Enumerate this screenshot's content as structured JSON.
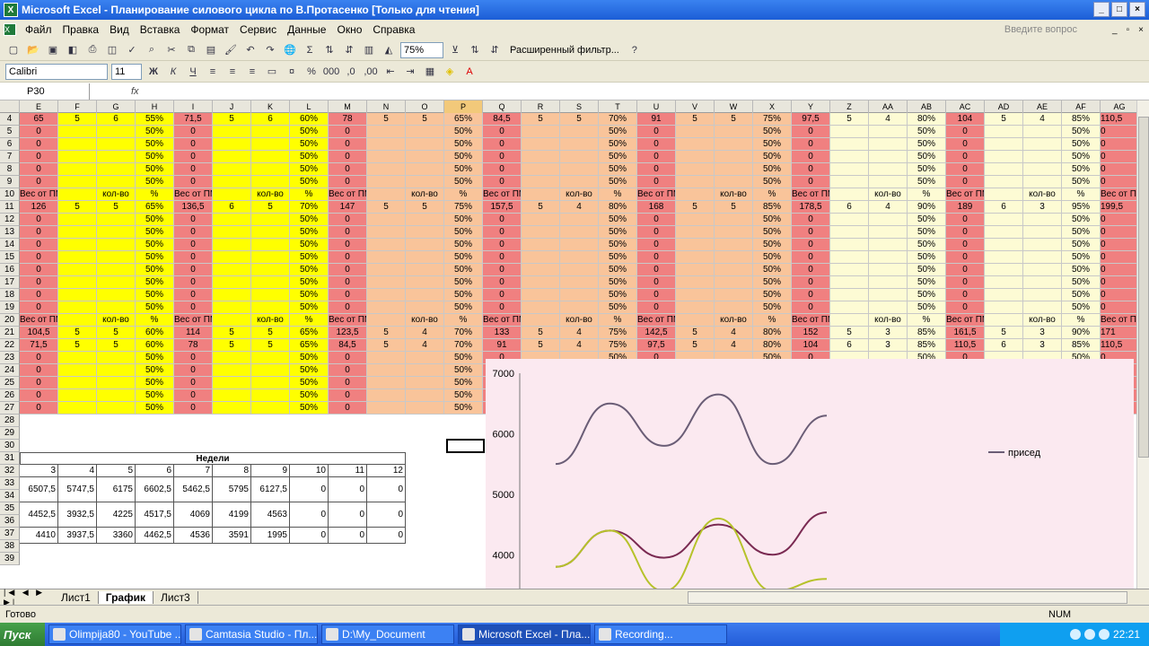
{
  "window": {
    "title": "Microsoft Excel - Планирование силового цикла по В.Протасенко  [Только для чтения]"
  },
  "menu": [
    "Файл",
    "Правка",
    "Вид",
    "Вставка",
    "Формат",
    "Сервис",
    "Данные",
    "Окно",
    "Справка"
  ],
  "ask_placeholder": "Введите вопрос",
  "toolbar": {
    "zoom": "75%",
    "filter_label": "Расширенный фильтр...",
    "font": "Calibri",
    "size": "11"
  },
  "namebox": "P30",
  "columns": [
    "E",
    "F",
    "G",
    "H",
    "I",
    "J",
    "K",
    "L",
    "M",
    "N",
    "O",
    "P",
    "Q",
    "R",
    "S",
    "T",
    "U",
    "V",
    "W",
    "X",
    "Y",
    "Z",
    "AA",
    "AB",
    "AC",
    "AD",
    "AE",
    "AF",
    "AG"
  ],
  "rows": {
    "r4": [
      "65",
      "5",
      "6",
      "55%",
      "71,5",
      "5",
      "6",
      "60%",
      "78",
      "5",
      "5",
      "65%",
      "84,5",
      "5",
      "5",
      "70%",
      "91",
      "5",
      "5",
      "75%",
      "97,5",
      "5",
      "4",
      "80%",
      "104",
      "5",
      "4",
      "85%",
      "110,5"
    ],
    "r11": [
      "126",
      "5",
      "5",
      "65%",
      "136,5",
      "6",
      "5",
      "70%",
      "147",
      "5",
      "5",
      "75%",
      "157,5",
      "5",
      "4",
      "80%",
      "168",
      "5",
      "5",
      "85%",
      "178,5",
      "6",
      "4",
      "90%",
      "189",
      "6",
      "3",
      "95%",
      "199,5"
    ],
    "r21": [
      "104,5",
      "5",
      "5",
      "60%",
      "114",
      "5",
      "5",
      "65%",
      "123,5",
      "5",
      "4",
      "70%",
      "133",
      "5",
      "4",
      "75%",
      "142,5",
      "5",
      "4",
      "80%",
      "152",
      "5",
      "3",
      "85%",
      "161,5",
      "5",
      "3",
      "90%",
      "171"
    ],
    "r22": [
      "71,5",
      "5",
      "5",
      "60%",
      "78",
      "5",
      "5",
      "65%",
      "84,5",
      "5",
      "4",
      "70%",
      "91",
      "5",
      "4",
      "75%",
      "97,5",
      "5",
      "4",
      "80%",
      "104",
      "6",
      "3",
      "85%",
      "110,5",
      "6",
      "3",
      "85%",
      "110,5"
    ],
    "header_row": [
      "Вес от ПМ",
      "кол-во",
      "%"
    ],
    "zero": "0",
    "fifty": "50%"
  },
  "table": {
    "title": "Недели",
    "weeks": [
      "3",
      "4",
      "5",
      "6",
      "7",
      "8",
      "9",
      "10",
      "11",
      "12"
    ],
    "row33": [
      "6507,5",
      "5747,5",
      "6175",
      "6602,5",
      "5462,5",
      "5795",
      "6127,5",
      "0",
      "0",
      "0"
    ],
    "row34": [
      "4452,5",
      "3932,5",
      "4225",
      "4517,5",
      "4069",
      "4199",
      "4563",
      "0",
      "0",
      "0"
    ],
    "row35": [
      "4410",
      "3937,5",
      "3360",
      "4462,5",
      "4536",
      "3591",
      "1995",
      "0",
      "0",
      "0"
    ]
  },
  "chart_data": {
    "type": "line",
    "yticks": [
      "7000",
      "6000",
      "5000",
      "4000"
    ],
    "ylim": [
      3500,
      7000
    ],
    "legend": [
      "присед"
    ],
    "series": [
      {
        "values": [
          5500,
          6500,
          5800,
          6650,
          5500,
          6300
        ]
      },
      {
        "values": [
          3800,
          4400,
          3950,
          4500,
          4000,
          4700
        ]
      },
      {
        "values": [
          3800,
          4400,
          3400,
          4600,
          3400,
          3600
        ]
      }
    ],
    "colors": [
      "#6a5d76",
      "#7a2a52",
      "#b6c22a"
    ]
  },
  "sheets": [
    "Лист1",
    "График",
    "Лист3"
  ],
  "status": "Готово",
  "num": "NUM",
  "taskbar": {
    "start": "Пуск",
    "tasks": [
      "Olimpija80 - YouTube ...",
      "Camtasia Studio - Пл...",
      "D:\\My_Document",
      "Microsoft Excel - Пла...",
      "Recording..."
    ],
    "clock": "22:21"
  },
  "colors": {
    "red": "#f08080",
    "yellow": "#ffff00",
    "orange": "#f9c49a",
    "cream": "#fdfbd4",
    "pink": "#fbe9f0"
  }
}
